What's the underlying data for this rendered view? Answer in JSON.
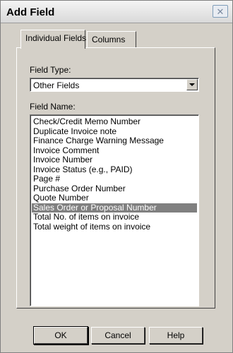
{
  "window": {
    "title": "Add Field",
    "close_symbol": "✕"
  },
  "tabs": [
    {
      "label": "Individual Fields",
      "active": true
    },
    {
      "label": "Columns",
      "active": false
    }
  ],
  "field_type": {
    "label": "Field Type:",
    "value": "Other Fields"
  },
  "field_name": {
    "label": "Field Name:",
    "items": [
      "Check/Credit Memo Number",
      "Duplicate Invoice note",
      "Finance Charge Warning Message",
      "Invoice Comment",
      "Invoice Number",
      "Invoice Status (e.g., PAID)",
      "Page #",
      "Purchase Order Number",
      "Quote Number",
      "Sales Order or Proposal Number",
      "Total No. of items on invoice",
      "Total weight of items on invoice"
    ],
    "selected_index": 9
  },
  "buttons": {
    "ok": "OK",
    "cancel": "Cancel",
    "help": "Help"
  },
  "colors": {
    "dialog_bg": "#d4d0c8",
    "selection_bg": "#808080",
    "selection_fg": "#ffffff"
  },
  "icons": {
    "close": "close-icon",
    "dropdown": "chevron-down-icon"
  }
}
